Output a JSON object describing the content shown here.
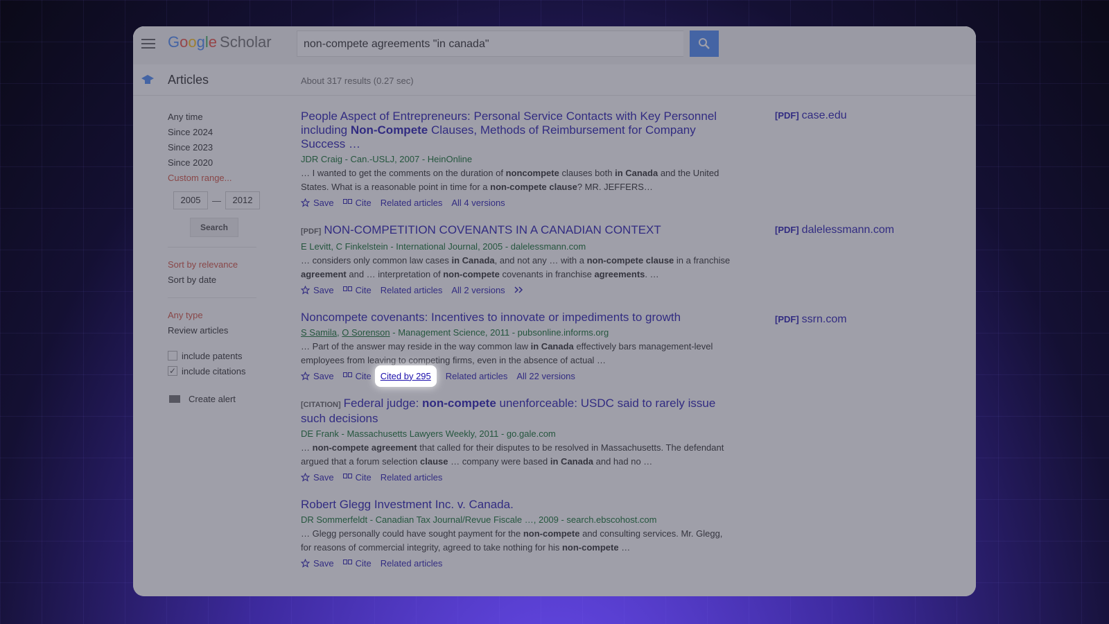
{
  "header": {
    "logo_google": [
      "G",
      "o",
      "o",
      "g",
      "l",
      "e"
    ],
    "logo_scholar": "Scholar",
    "search_query": "non-compete agreements \"in canada\""
  },
  "subheader": {
    "articles_label": "Articles",
    "results_count": "About 317 results (0.27 sec)"
  },
  "sidebar": {
    "time_filters": [
      "Any time",
      "Since 2024",
      "Since 2023",
      "Since 2020"
    ],
    "custom_range": "Custom range...",
    "year_from": "2005",
    "year_dash": "—",
    "year_to": "2012",
    "search_button": "Search",
    "sort_relevance": "Sort by relevance",
    "sort_date": "Sort by date",
    "any_type": "Any type",
    "review_articles": "Review articles",
    "include_patents": "include patents",
    "include_citations": "include citations",
    "create_alert": "Create alert"
  },
  "results": [
    {
      "title_parts": [
        "People Aspect of Entrepreneurs: Personal Service Contacts with Key Personnel including ",
        "Non-Compete",
        " Clauses, Methods of Reimbursement for Company Success …"
      ],
      "meta": "JDR Craig - Can.-USLJ, 2007 - HeinOnline",
      "snippet_parts": [
        "… I wanted to get the comments on the duration of ",
        "noncompete",
        " clauses both ",
        "in Canada",
        " and the United States. What is a reasonable point in time for a ",
        "non-compete clause",
        "? MR. JEFFERS…"
      ],
      "actions": [
        "Save",
        "Cite",
        "Related articles",
        "All 4 versions"
      ],
      "side": {
        "tag": "[PDF]",
        "domain": "case.edu"
      }
    },
    {
      "tag": "[PDF]",
      "title": "NON-COMPETITION COVENANTS IN A CANADIAN CONTEXT",
      "meta": "E Levitt, C Finkelstein - International Journal, 2005 - dalelessmann.com",
      "snippet_parts": [
        "… considers only common law cases ",
        "in Canada",
        ", and not any … with a ",
        "non-compete clause",
        " in a franchise ",
        "agreement",
        " and … interpretation of ",
        "non-compete",
        " covenants in franchise ",
        "agreements",
        ". …"
      ],
      "actions": [
        "Save",
        "Cite",
        "Related articles",
        "All 2 versions"
      ],
      "side": {
        "tag": "[PDF]",
        "domain": "dalelessmann.com"
      }
    },
    {
      "title": "Noncompete covenants: Incentives to innovate or impediments to growth",
      "authors": [
        "S Samila",
        "O Sorenson"
      ],
      "meta_rest": " - Management Science, 2011 - pubsonline.informs.org",
      "snippet_parts": [
        "… Part of the answer may reside in the way common law ",
        "in Canada",
        " effectively bars management-level employees from leaving to competing firms, even in the absence of actual …"
      ],
      "actions": [
        "Save",
        "Cite",
        "Cited by 295",
        "Related articles",
        "All 22 versions"
      ],
      "side": {
        "tag": "[PDF]",
        "domain": "ssrn.com"
      }
    },
    {
      "tag": "[CITATION]",
      "title_parts": [
        "Federal judge: ",
        "non-compete",
        " unenforceable: USDC said to rarely issue such decisions"
      ],
      "meta": "DE Frank - Massachusetts Lawyers Weekly, 2011 - go.gale.com",
      "snippet_parts": [
        "… ",
        "non-compete agreement",
        " that called for their disputes to be resolved in Massachusetts. The defendant argued that a forum selection ",
        "clause",
        " … company were based ",
        "in Canada",
        " and had no …"
      ],
      "actions": [
        "Save",
        "Cite",
        "Related articles"
      ]
    },
    {
      "title": "Robert Glegg Investment Inc. v. Canada.",
      "meta": "DR Sommerfeldt - Canadian Tax Journal/Revue Fiscale …, 2009 - search.ebscohost.com",
      "snippet_parts": [
        "… Glegg personally could have sought payment for the ",
        "non-compete",
        " and consulting services. Mr. Glegg, for reasons of commercial integrity, agreed to take nothing for his ",
        "non-compete",
        " …"
      ],
      "actions": [
        "Save",
        "Cite",
        "Related articles"
      ]
    }
  ]
}
